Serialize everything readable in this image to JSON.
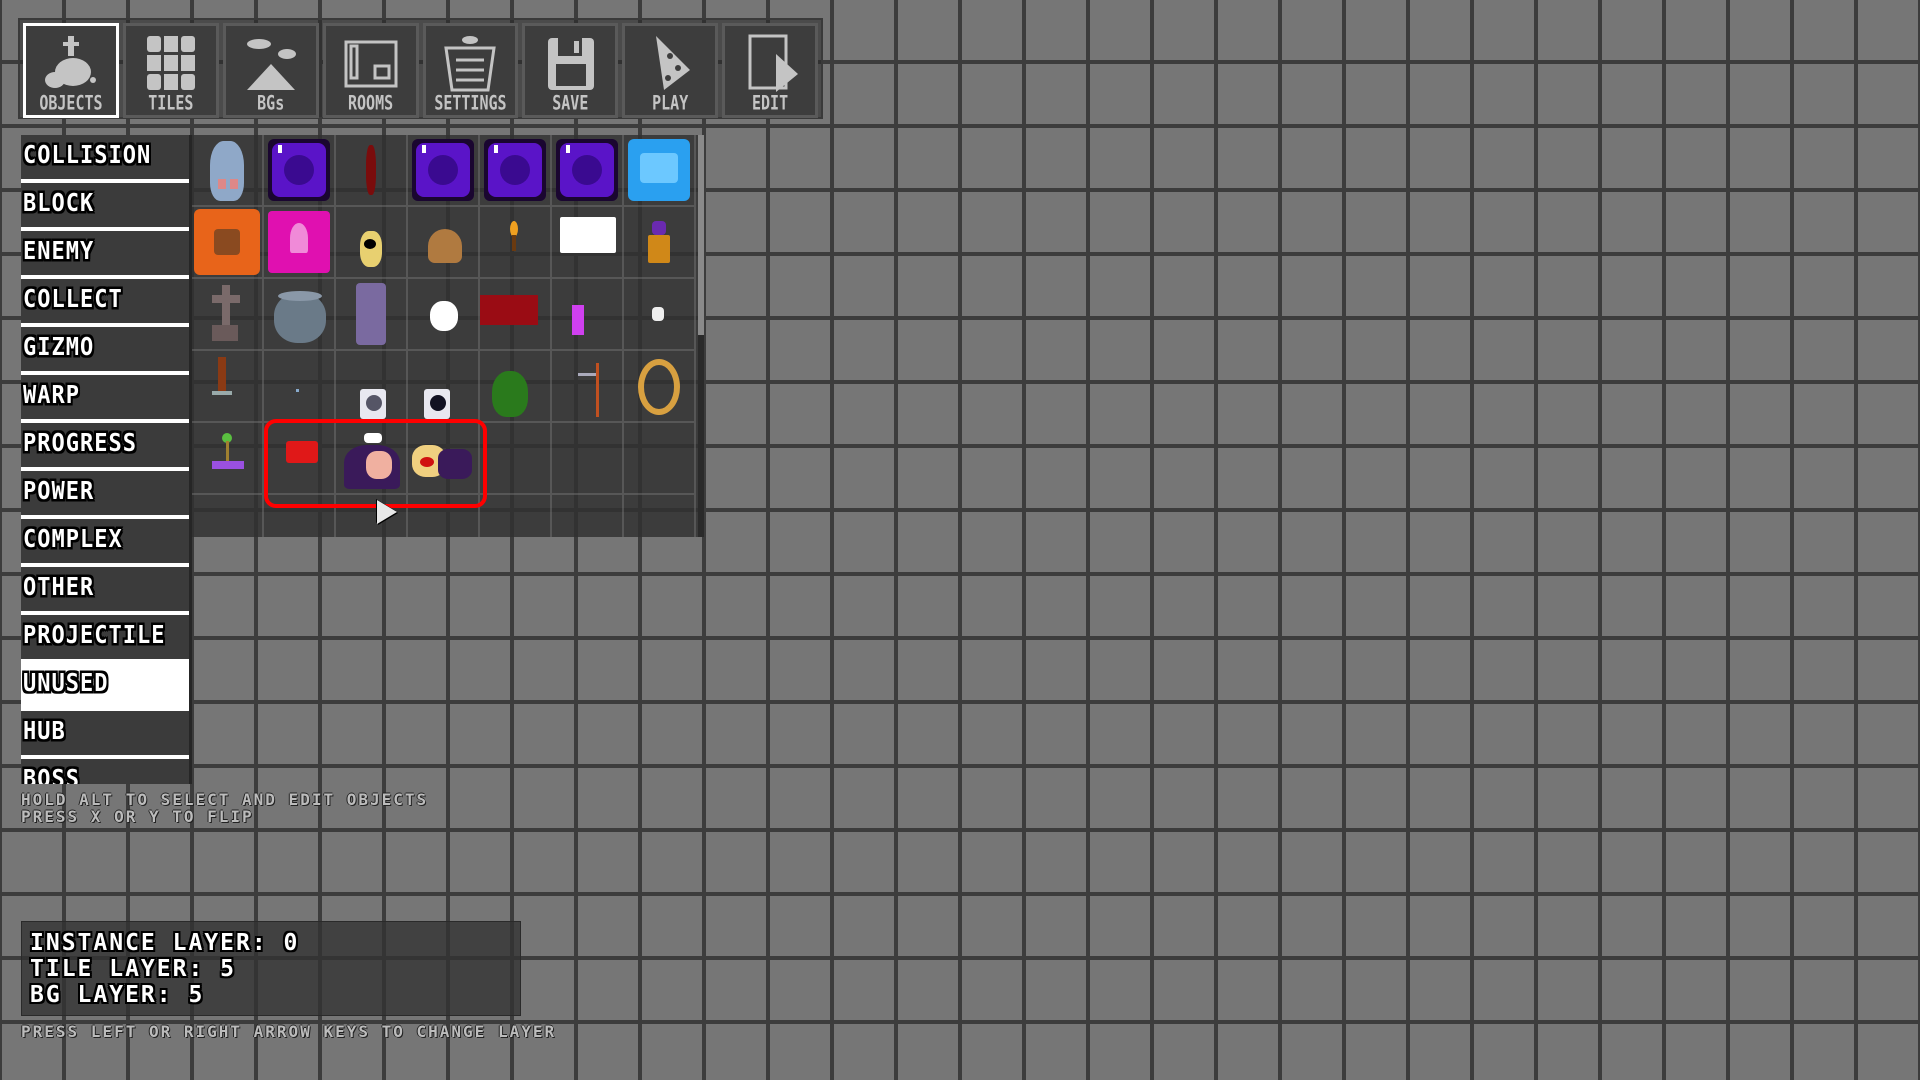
{
  "toolbar": {
    "buttons": [
      {
        "label": "OBJECTS",
        "icon": "objects-icon",
        "active": true
      },
      {
        "label": "TILES",
        "icon": "tiles-icon"
      },
      {
        "label": "BGs",
        "icon": "backgrounds-icon"
      },
      {
        "label": "ROOMS",
        "icon": "rooms-icon"
      },
      {
        "label": "SETTINGS",
        "icon": "settings-icon"
      },
      {
        "label": "SAVE",
        "icon": "save-icon"
      },
      {
        "label": "PLAY",
        "icon": "play-icon"
      },
      {
        "label": "EDIT",
        "icon": "edit-icon"
      }
    ]
  },
  "sidebar": {
    "items": [
      "COLLISION",
      "BLOCK",
      "ENEMY",
      "COLLECT",
      "GIZMO",
      "WARP",
      "PROGRESS",
      "POWER",
      "COMPLEX",
      "OTHER",
      "PROJECTILE",
      "UNUSED",
      "HUB",
      "BOSS"
    ],
    "selected": "UNUSED"
  },
  "objects": {
    "cells": [
      "rat",
      "purple-bomb-block",
      "red-blade",
      "purple-bomb-block",
      "purple-bomb-block",
      "purple-bomb-block",
      "ice-block",
      "orange-rock-block",
      "pink-mystery-block",
      "small-yellow-enemy",
      "brown-boulder",
      "torch",
      "white-panel",
      "purple-statue",
      "gravestone",
      "gray-pot",
      "purple-pillar-face",
      "white-cloud",
      "dark-red-block",
      "magenta-bar",
      "small-white-figure",
      "sword",
      "tiny-dot",
      "washing-machine-open",
      "washing-machine",
      "green-sack",
      "hook-pole",
      "gold-ring",
      "green-lever",
      "p1-marker",
      "pepperman-wizard",
      "noise-wizard",
      "empty",
      "empty",
      "empty"
    ],
    "highlight_color": "#ff0000"
  },
  "hints": {
    "line1": "HOLD ALT TO SELECT AND EDIT OBJECTS",
    "line2": "PRESS X OR Y TO FLIP",
    "bottom": "PRESS LEFT OR RIGHT ARROW KEYS TO CHANGE LAYER"
  },
  "layers": {
    "instance": "INSTANCE LAYER: 0",
    "tile": "TILE LAYER: 5",
    "bg": "BG LAYER: 5"
  }
}
